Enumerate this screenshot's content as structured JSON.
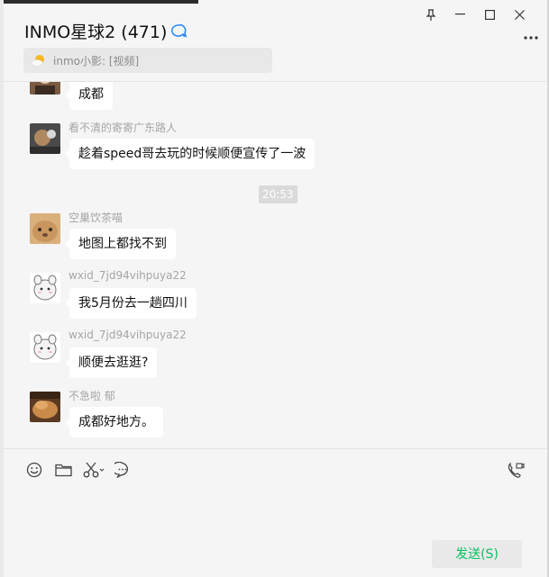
{
  "window": {
    "pin_icon": "pin-icon",
    "minimize_icon": "minimize-icon",
    "maximize_icon": "maximize-icon",
    "close_icon": "close-icon",
    "more_icon": "more-dots-icon"
  },
  "header": {
    "title": "INMO星球2 (471)",
    "announcement": "inmo小影: [视频]"
  },
  "messages": [
    {
      "sender": "",
      "text": "成都"
    },
    {
      "sender": "看不清的寄寄广东路人",
      "text": "趁着speed哥去玩的时候顺便宣传了一波"
    },
    {
      "time": "20:53"
    },
    {
      "sender": "空巢饮茶喵",
      "text": "地图上都找不到"
    },
    {
      "sender": "wxid_7jd94vihpuya22",
      "text": "我5月份去一趟四川"
    },
    {
      "sender": "wxid_7jd94vihpuya22",
      "text": "顺便去逛逛?"
    },
    {
      "sender": "不急啦 郁",
      "text": "成都好地方。"
    }
  ],
  "toolbar": {
    "icons": [
      "emoji-icon",
      "folder-icon",
      "scissors-icon",
      "chat-bubble-icon",
      "video-call-icon"
    ]
  },
  "input": {
    "send_label": "发送(S)"
  },
  "colors": {
    "accent": "#07c160",
    "background": "#f5f5f5",
    "bubble": "#ffffff"
  }
}
